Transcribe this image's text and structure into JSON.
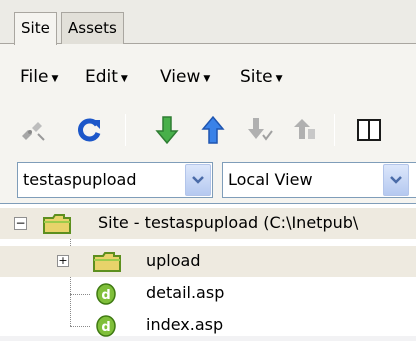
{
  "tabs": [
    {
      "label": "Site",
      "active": true
    },
    {
      "label": "Assets",
      "active": false
    }
  ],
  "menu": [
    {
      "label": "File"
    },
    {
      "label": "Edit"
    },
    {
      "label": "View"
    },
    {
      "label": "Site"
    }
  ],
  "toolbar": {
    "icons": [
      "connect-icon",
      "refresh-icon",
      "get-files-icon",
      "put-files-icon",
      "check-out-icon",
      "check-in-icon",
      "expand-panel-icon"
    ]
  },
  "site_select": {
    "value": "testaspupload"
  },
  "view_select": {
    "value": "Local View"
  },
  "tree": {
    "root": {
      "label": "Site - testaspupload (C:\\Inetpub\\"
    },
    "items": [
      {
        "label": "upload",
        "type": "folder"
      },
      {
        "label": "detail.asp",
        "type": "asp-file"
      },
      {
        "label": "index.asp",
        "type": "asp-file"
      }
    ]
  },
  "colors": {
    "accent": "#2f6fd6",
    "folder": "#e8d36a",
    "highlight": "#eeeae0"
  }
}
